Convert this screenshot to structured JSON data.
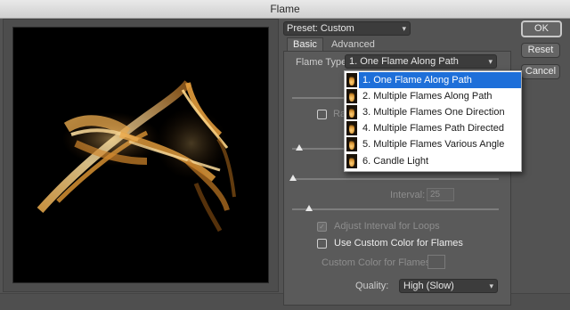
{
  "window": {
    "title": "Flame"
  },
  "preset": {
    "label": "Preset: Custom"
  },
  "tabs": [
    {
      "label": "Basic"
    },
    {
      "label": "Advanced"
    }
  ],
  "flame_type": {
    "label": "Flame Type:",
    "selected": "1. One Flame Along Path",
    "options": [
      "1. One Flame Along Path",
      "2. Multiple Flames Along Path",
      "3. Multiple Flames One Direction",
      "4. Multiple Flames Path Directed",
      "5. Multiple Flames Various Angle",
      "6. Candle Light"
    ]
  },
  "partial_labels": {
    "checkbox_fragment": "Ra"
  },
  "interval": {
    "label": "Interval:",
    "value": "25"
  },
  "adjust_interval": {
    "label": "Adjust Interval for Loops",
    "checked": true,
    "disabled": true
  },
  "custom_color": {
    "label": "Use Custom Color for Flames",
    "checked": false
  },
  "custom_color_field": {
    "label": "Custom Color for Flames:"
  },
  "quality": {
    "label": "Quality:",
    "value": "High (Slow)"
  },
  "buttons": {
    "ok": "OK",
    "reset": "Reset",
    "cancel": "Cancel"
  },
  "colors": {
    "highlight": "#1e6fd9",
    "panel": "#535353",
    "flame": "#f0a640"
  }
}
